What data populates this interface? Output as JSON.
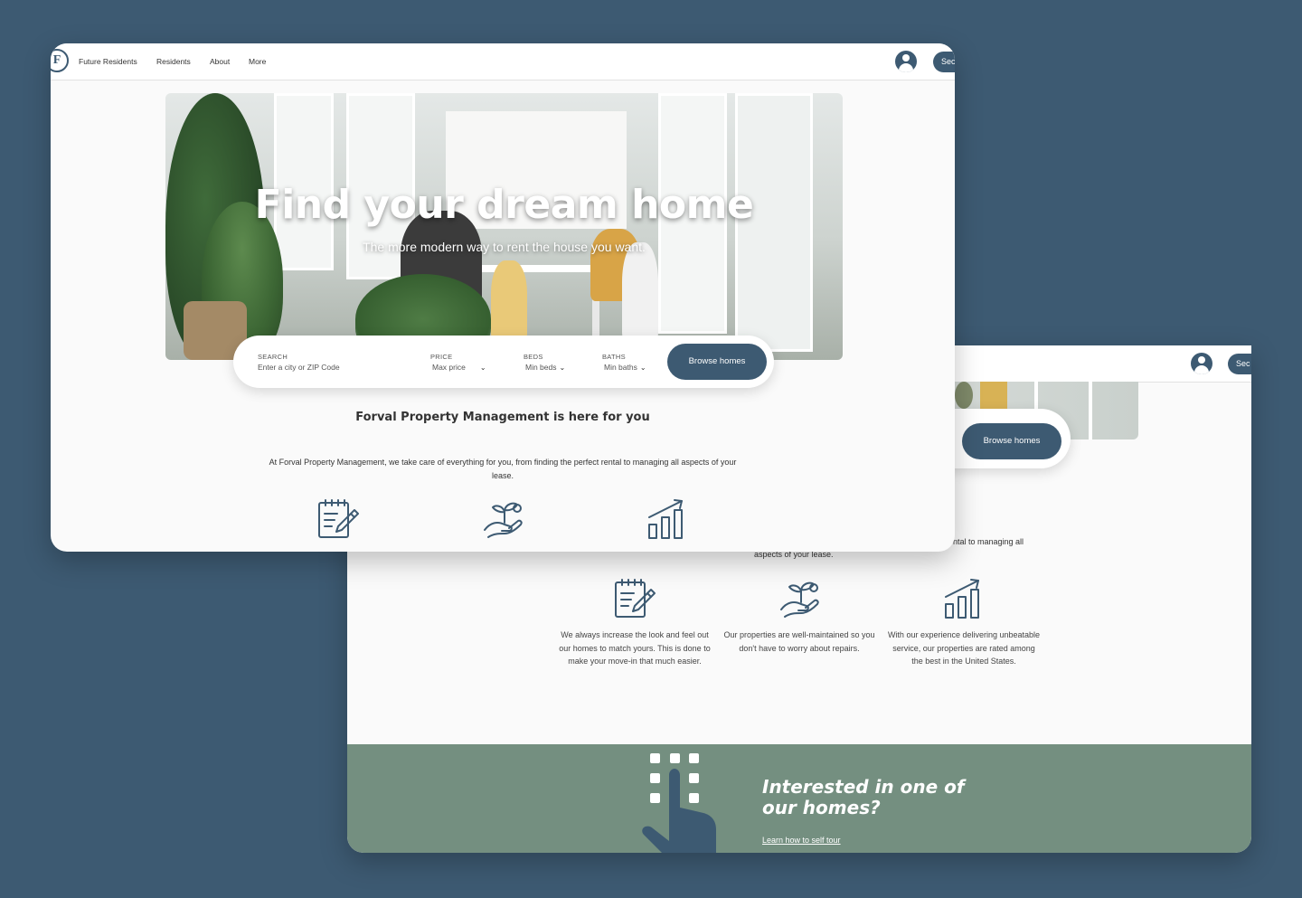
{
  "nav": {
    "logo_letter": "F",
    "links": [
      "Future Residents",
      "Residents",
      "About",
      "More"
    ],
    "cta_button": "Sec"
  },
  "hero": {
    "title": "Find your dream home",
    "subtitle": "The more modern way to rent the house you want."
  },
  "search": {
    "search_label": "SEARCH",
    "search_placeholder": "Enter a city or ZIP Code",
    "price_label": "PRICE",
    "price_value": "Max price",
    "beds_label": "BEDS",
    "beds_value": "Min beds",
    "baths_label": "BATHS",
    "baths_value": "Min baths",
    "browse_button": "Browse homes"
  },
  "about": {
    "title": "Forval Property Management is here for you",
    "description": "At Forval Property Management, we take care of everything for you, from finding the perfect rental to managing all aspects of your lease.",
    "desc_fragment_right": "ntal to managing all",
    "desc_fragment_bottom": "aspects of your lease."
  },
  "features": [
    {
      "icon": "checklist-pencil-icon",
      "text": "We always increase the look and feel out our homes to match yours. This is done to make your move-in that much easier."
    },
    {
      "icon": "plant-hand-icon",
      "text": "Our properties are well-maintained so you don't have to worry about repairs."
    },
    {
      "icon": "growth-chart-icon",
      "text": "With our experience delivering unbeatable service, our properties are rated among the best in the United States."
    }
  ],
  "cta": {
    "title": "Interested in one of our homes?",
    "link": "Learn how to self tour"
  },
  "colors": {
    "background": "#3d5a72",
    "primary": "#3d5a72",
    "cta_band": "#748f80",
    "page": "#fafafa"
  }
}
